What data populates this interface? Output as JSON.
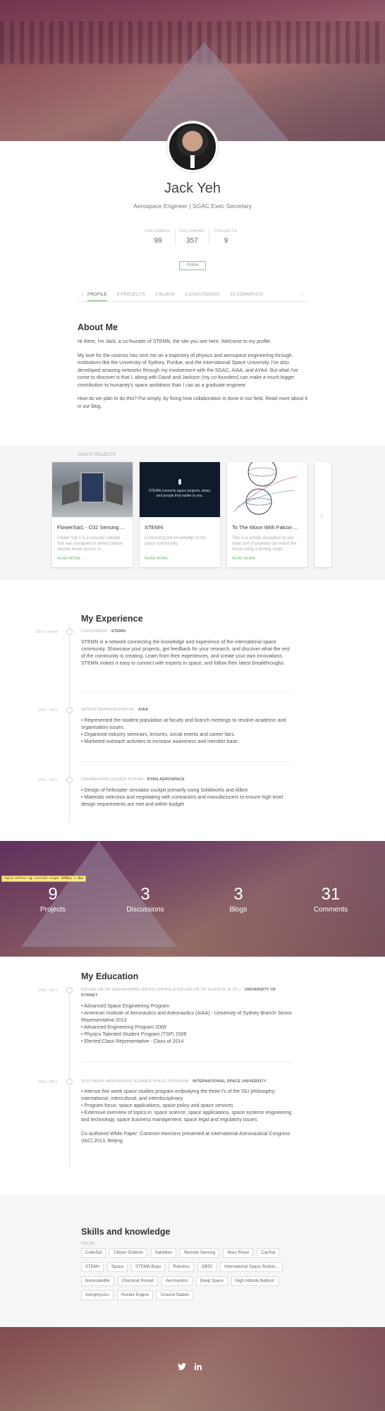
{
  "profile": {
    "name": "Jack Yeh",
    "tagline": "Aerospace Engineer | SGAC Exec Secretary",
    "stats": [
      {
        "label": "FOLLOWERS",
        "value": "99"
      },
      {
        "label": "FOLLOWING",
        "value": "357"
      },
      {
        "label": "PROJECTS",
        "value": "9"
      }
    ],
    "follow_label": "Follow"
  },
  "tabs": [
    "PROFILE",
    "9 PROJECTS",
    "3 BLOGS",
    "3 DISCUSSIONS",
    "31 COMMENTS"
  ],
  "about": {
    "title": "About Me",
    "paragraphs": [
      "Hi there, I'm Jack, a co-founder of STEMN, the site you see here. Welcome to my profile.",
      "My love for the cosmos has sent me on a trajectory of physics and aerospace engineering through institutions like the University of Sydney, Purdue, and the International Space University. I've also developed amazing networks through my involvement with the SGAC, AIAA, and AYAA. But what I've come to discover is that I, along with David and Jackson (my co-founders) can make a much bigger contribution to humanity's space ambitions than I can as a graduate engineer.",
      "How do we plan to do this? Put simply, by fixing how collaboration is done in our field. Read more about it in our blog."
    ]
  },
  "projects": {
    "label": "JACK'S PROJECTS",
    "read_more": "READ MORE",
    "items": [
      {
        "title": "FlowerSat1 - C02 Sensing ...",
        "desc": "Flower Sat 1 is a concept satellite that was designed to detect carbon dioxide levels across to..."
      },
      {
        "title": "STEMN",
        "desc": "Connecting the knowledge of the space community.",
        "img_text": "STEMN connects space projects, ideas, and people that matter to you."
      },
      {
        "title": "To The Moon With Falcon ...",
        "desc": "This is a simple simulation to see what sort of payload can reach the moon using a terribly simpl..."
      }
    ]
  },
  "experience": {
    "title": "My Experience",
    "items": [
      {
        "date": "2014 - current",
        "role": "COFOUNDER",
        "org": "STEMN",
        "body": [
          "STEMN is a network connecting the knowledge and experience of the international space community. Showcase your projects, get feedback for your research, and discover what the rest of the community is creating. Learn from their experiences, and create your own innovations. STEMN makes it easy to connect with experts in space, and follow their latest breakthroughs."
        ]
      },
      {
        "date": "2013 - 2013",
        "role": "SENIOR REPRESENTATIVE",
        "org": "AIAA",
        "body": [
          "• Represented the student population at faculty and branch meetings to resolve academic and organisation issues.",
          "• Organised industry seminars, lectures, social events and career fairs.",
          "• Marketed outreach activities to increase awareness and member base."
        ]
      },
      {
        "date": "2012 - 2012",
        "role": "ENGINEERING DESIGN INTERN",
        "org": "RYAN AEROSPACE",
        "body": [
          "• Design of helicopter simulator cockpit primarily using Solidworks and Alibre",
          "• Materials selection and negotiating with contractors and manufacturers to ensure high level design requirements are met and within budget"
        ]
      }
    ]
  },
  "debug_tag": "reply-editor.ng-isolate-scope 1099px × 0px",
  "counters": [
    {
      "n": "9",
      "l": "Projects"
    },
    {
      "n": "3",
      "l": "Discussions"
    },
    {
      "n": "3",
      "l": "Blogs"
    },
    {
      "n": "31",
      "l": "Comments"
    }
  ],
  "education": {
    "title": "My Education",
    "items": [
      {
        "date": "2009 - 2014",
        "role": "BACHELOR OF ENGINEERING (BENG) (HONS) & BACHELOR OF SCIENCE (B.SC.)",
        "org": "UNIVERSITY OF SYDNEY",
        "body": [
          "• Advanced Space Engineering Program",
          "• American Institute of Aeronautics and Astronautics (AIAA) - University of Sydney Branch Senior Representative 2013",
          "• Advanced Engineering Program 2009",
          "• Physics Talented Student Program (TSP) 2009",
          "• Elected Class Representative - Class of 2014"
        ]
      },
      {
        "date": "2013 - 2013",
        "role": "SOUTHERN HEMISPHERE SUMMER SPACE PROGRAM",
        "org": "INTERNATIONAL SPACE UNIVERSITY",
        "body": [
          "• Intense five week space studies program embodying the three I's of the ISU philosophy: international, intercultural, and interdisciplinary.",
          "• Program focus: space applications, space policy and space services",
          "• Extensive overview of topics in: space science, space applications, space systems engineering and technology, space business management, space legal and regulatory issues",
          "",
          "Co-authored White Paper: Common Horizons presented at International Astronautical Congress (IAC) 2013, Beijing"
        ]
      }
    ]
  },
  "skills": {
    "title": "Skills and knowledge",
    "fields_label": "FIELDS",
    "chips": [
      "CubeSat",
      "Citizen Science",
      "Satellites",
      "Remote Sensing",
      "Mars Rover",
      "CanSat",
      "STEMn",
      "Space",
      "STEMN Bugs",
      "Robotics",
      "QB50",
      "International Space Station...",
      "Nanosatellite",
      "Chemical Rocket",
      "Aeronautics",
      "Deep Space",
      "High Altitude Balloon",
      "Astrophysics",
      "Rocket Engine",
      "Ground Station"
    ]
  },
  "footer": {
    "icons": [
      "twitter-icon",
      "linkedin-icon"
    ]
  },
  "colors": {
    "accent": "#6aa86a",
    "text": "#555555",
    "band": "#f5f5f5"
  }
}
